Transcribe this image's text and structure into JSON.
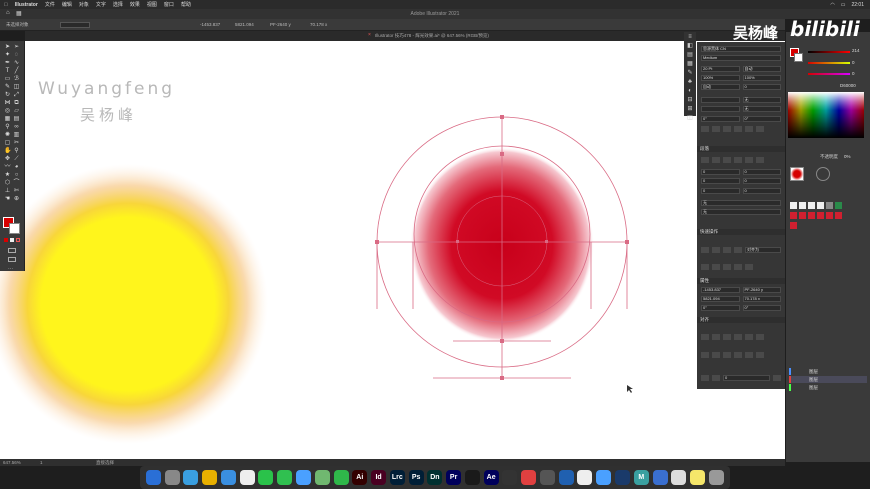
{
  "menubar": {
    "app": "Illustrator",
    "items": [
      "文件",
      "编辑",
      "对象",
      "文字",
      "选择",
      "效果",
      "视图",
      "窗口",
      "帮助"
    ],
    "clock": "22:01"
  },
  "window": {
    "title": "Adobe Illustrator 2021"
  },
  "controlbar": {
    "fields": [
      "未选择对象",
      "-1453.837",
      "5821.094",
      "PF-2640 y",
      "70.178 x"
    ]
  },
  "document_tab": {
    "label": "Illustrator 技巧478 - 辉光效果.ai* @ 647.56% (RGB/预览)"
  },
  "watermark": {
    "en": "Wuyangfeng",
    "cn": "吴杨峰"
  },
  "brand": {
    "cn": "吴杨峰",
    "logo": "bilibili"
  },
  "properties_panel": {
    "font_name": "思源黑体 CN",
    "font_style": "Medium",
    "size": "20 Pt",
    "leading": "自动",
    "tracking": "0",
    "scale_v": "100%",
    "scale_h": "100%",
    "sections": [
      "字符",
      "段落",
      "描边",
      "外观",
      "对齐",
      "快速操作",
      "属性",
      "图层"
    ],
    "dropdown_a": "无",
    "dropdown_b": "无",
    "x_field": "-1453.837",
    "y_field": "5821.094",
    "w_field": "PF-2640 y",
    "h_field": "70.178 x",
    "angle": "0°",
    "snap_label": "对齐为"
  },
  "color_panel": {
    "r": "214",
    "g": "0",
    "b": "0",
    "hex": "D60000",
    "opacity_label": "不透明度",
    "opacity": "0%"
  },
  "layers": [
    {
      "name": "图层",
      "color": "#4a90ff"
    },
    {
      "name": "图层",
      "color": "#e04040"
    },
    {
      "name": "图层",
      "color": "#4aff4a"
    }
  ],
  "statusbar": {
    "zoom": "647.56%",
    "artboard": "1",
    "tool": "直接选择"
  },
  "dock": [
    {
      "name": "finder",
      "label": "",
      "color": "#2a6fd6"
    },
    {
      "name": "launchpad",
      "label": "",
      "color": "#888"
    },
    {
      "name": "safari",
      "label": "",
      "color": "#3a9fe0"
    },
    {
      "name": "chrome",
      "label": "",
      "color": "#e8b000"
    },
    {
      "name": "mail",
      "label": "",
      "color": "#3a8fe0"
    },
    {
      "name": "calendar",
      "label": "",
      "color": "#eee"
    },
    {
      "name": "wechat",
      "label": "",
      "color": "#2ac24a"
    },
    {
      "name": "messages",
      "label": "",
      "color": "#30c050"
    },
    {
      "name": "qq",
      "label": "",
      "color": "#4aa0ff"
    },
    {
      "name": "maps",
      "label": "",
      "color": "#70b870"
    },
    {
      "name": "facetime",
      "label": "",
      "color": "#2fb84a"
    },
    {
      "name": "illustrator",
      "label": "Ai",
      "color": "#330000"
    },
    {
      "name": "indesign",
      "label": "Id",
      "color": "#490021"
    },
    {
      "name": "lightroom",
      "label": "Lrc",
      "color": "#001e36"
    },
    {
      "name": "photoshop",
      "label": "Ps",
      "color": "#001e36"
    },
    {
      "name": "dimension",
      "label": "Dn",
      "color": "#003030"
    },
    {
      "name": "premiere",
      "label": "Pr",
      "color": "#00005b"
    },
    {
      "name": "claquette",
      "label": "",
      "color": "#1a1a1a"
    },
    {
      "name": "aftereffects",
      "label": "Ae",
      "color": "#00005b"
    },
    {
      "name": "davinci",
      "label": "",
      "color": "#333"
    },
    {
      "name": "tencent",
      "label": "",
      "color": "#e04040"
    },
    {
      "name": "system-prefs",
      "label": "",
      "color": "#555"
    },
    {
      "name": "cinema4d",
      "label": "",
      "color": "#2060b0"
    },
    {
      "name": "hdr",
      "label": "",
      "color": "#eee"
    },
    {
      "name": "maps2",
      "label": "",
      "color": "#4aa0ff"
    },
    {
      "name": "xmind",
      "label": "",
      "color": "#1a3a6a"
    },
    {
      "name": "motion",
      "label": "M",
      "color": "#3aa0a0"
    },
    {
      "name": "quicktime",
      "label": "",
      "color": "#3a6fd0"
    },
    {
      "name": "preview",
      "label": "",
      "color": "#ddd"
    },
    {
      "name": "notes",
      "label": "",
      "color": "#f5e66a"
    },
    {
      "name": "trash",
      "label": "",
      "color": "#999"
    }
  ]
}
